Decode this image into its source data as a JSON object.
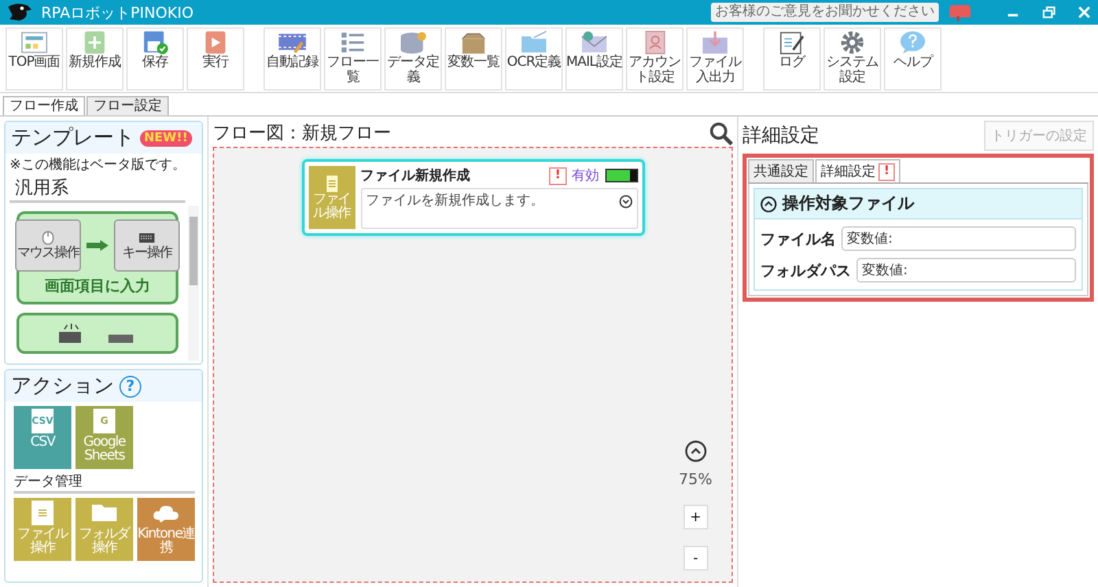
{
  "window": {
    "title": "RPAロボットPINOKIO",
    "feedback": "お客様のご意見をお聞かせください"
  },
  "toolbar": [
    [
      {
        "label": "TOP画面",
        "kind": "top"
      },
      {
        "label": "新規作成",
        "kind": "new"
      },
      {
        "label": "保存",
        "kind": "save"
      },
      {
        "label": "実行",
        "kind": "run"
      }
    ],
    [
      {
        "label": "自動記録",
        "kind": "record"
      },
      {
        "label": "フロー一覧",
        "kind": "list"
      },
      {
        "label": "データ定義",
        "kind": "data"
      },
      {
        "label": "変数一覧",
        "kind": "vars"
      },
      {
        "label": "OCR定義",
        "kind": "ocr"
      },
      {
        "label": "MAIL設定",
        "kind": "mail"
      },
      {
        "label": "アカウント設定",
        "kind": "account"
      },
      {
        "label": "ファイル入出力",
        "kind": "fileio"
      }
    ],
    [
      {
        "label": "ログ",
        "kind": "log"
      },
      {
        "label": "システム設定",
        "kind": "settings"
      },
      {
        "label": "ヘルプ",
        "kind": "help"
      }
    ]
  ],
  "mode_tabs": [
    {
      "label": "フロー作成",
      "selected": true
    },
    {
      "label": "フロー設定",
      "selected": false
    }
  ],
  "template_panel": {
    "title": "テンプレート",
    "badge": "NEW!!",
    "note": "※この機能はベータ版です。",
    "section": "汎用系",
    "cards": [
      {
        "label": "画面項目に入力",
        "from": "マウス操作",
        "to": "キー操作"
      }
    ]
  },
  "action_panel": {
    "title": "アクション",
    "help": "?",
    "groups": [
      {
        "tiles": [
          {
            "label": "CSV",
            "glyph": "CSV",
            "color": "#4aa3a0",
            "kind": "doc"
          },
          {
            "label": "Google Sheets",
            "glyph": "G",
            "color": "#9ea84a",
            "kind": "doc"
          }
        ]
      },
      {
        "heading": "データ管理",
        "tiles": [
          {
            "label": "ファイル操作",
            "color": "#c5b44a",
            "kind": "doc"
          },
          {
            "label": "フォルダ操作",
            "color": "#c5b44a",
            "kind": "folder"
          },
          {
            "label": "Kintone連携",
            "color": "#c98a45",
            "kind": "cloud"
          }
        ]
      }
    ]
  },
  "canvas": {
    "title": "フロー図：新規フロー",
    "node": {
      "title": "ファイル新規作成",
      "icon_label": "ファイル操作",
      "warning": "!",
      "status": "有効",
      "enabled": true,
      "description": "ファイルを新規作成します。"
    },
    "zoom": "75%",
    "zoom_in": "+",
    "zoom_out": "-"
  },
  "detail": {
    "title": "詳細設定",
    "trigger_button": {
      "label": "トリガーの設定",
      "disabled": true
    },
    "tabs": [
      {
        "label": "共通設定",
        "selected": false
      },
      {
        "label": "詳細設定",
        "selected": true,
        "warning": "!"
      }
    ],
    "section": {
      "title": "操作対象ファイル",
      "expanded": true,
      "fields": [
        {
          "label": "ファイル名",
          "value": "変数値:"
        },
        {
          "label": "フォルダパス",
          "value": "変数値:"
        }
      ]
    }
  }
}
